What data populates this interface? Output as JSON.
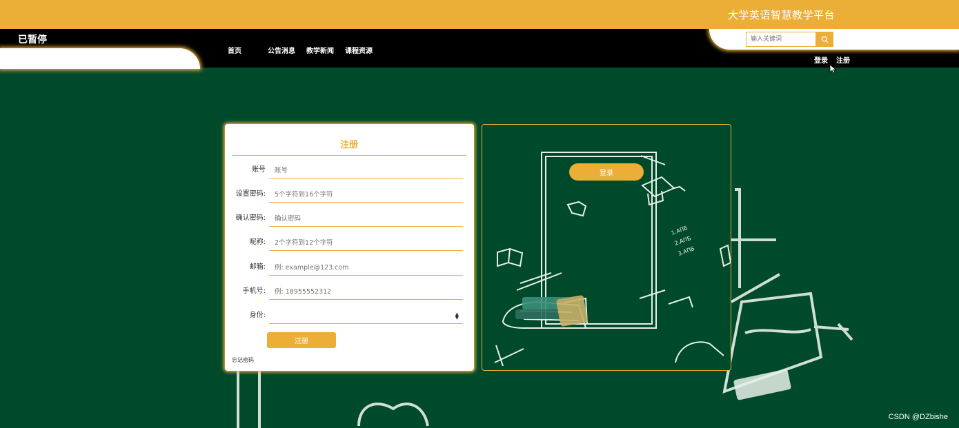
{
  "header": {
    "platform_title": "大学英语智慧教学平台",
    "paused_label": "已暂停",
    "nav": [
      "首页",
      "公告消息",
      "教学新闻",
      "课程资源"
    ],
    "search_placeholder": "输入关键词",
    "login_label": "登录",
    "register_label": "注册"
  },
  "register_form": {
    "title": "注册",
    "fields": [
      {
        "label": "账号",
        "placeholder": "账号"
      },
      {
        "label": "设置密码:",
        "placeholder": "5个字符到16个字符"
      },
      {
        "label": "确认密码:",
        "placeholder": "确认密码"
      },
      {
        "label": "昵称:",
        "placeholder": "2个字符到12个字符"
      },
      {
        "label": "邮箱:",
        "placeholder": "例: example@123.com"
      },
      {
        "label": "手机号:",
        "placeholder": "例: 18955552312"
      },
      {
        "label": "身份:",
        "placeholder": ""
      }
    ],
    "submit_label": "注册",
    "forgot_label": "忘记密码"
  },
  "login_panel": {
    "login_label": "登录"
  },
  "watermark": "CSDN @DZbishe",
  "colors": {
    "accent": "#ebae36",
    "board_green": "#004a2c",
    "nav_black": "#000000"
  }
}
